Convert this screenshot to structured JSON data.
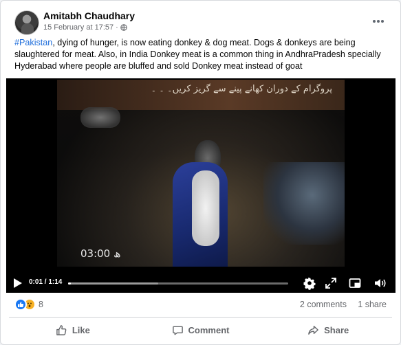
{
  "post": {
    "author": "Amitabh Chaudhary",
    "timestamp": "15 February at 17:57",
    "separator": "·",
    "audience_icon": "globe-icon",
    "hashtag": "#Pakistan",
    "body": ", dying of hunger, is now eating donkey & dog meat. Dogs & donkeys are being slaughtered for meat. Also, in India Donkey meat is a common thing in AndhraPradesh specially Hyderabad where people are bluffed and sold Donkey meat instead of goat"
  },
  "video": {
    "overlay_caption": "پروگرام کے دوران کھانے پینے سے گریز کریں۔ ۔ ۔",
    "overlay_timecode": "03:00 ھ",
    "current_time": "0:01",
    "duration": "1:14",
    "time_display": "0:01 / 1:14",
    "progress_fraction": 0.0135,
    "buffered_fraction": 0.41,
    "controls": [
      "play-icon",
      "settings-gear-icon",
      "expand-icon",
      "picture-in-picture-icon",
      "volume-icon"
    ]
  },
  "stats": {
    "reactions": [
      "like",
      "wow"
    ],
    "reaction_count": "8",
    "comments": "2 comments",
    "shares": "1 share"
  },
  "actions": {
    "like": "Like",
    "comment": "Comment",
    "share": "Share"
  },
  "colors": {
    "link": "#216fdb",
    "like_blue": "#1877f2",
    "wow_yellow": "#f7b125",
    "secondary_text": "#65676b"
  }
}
